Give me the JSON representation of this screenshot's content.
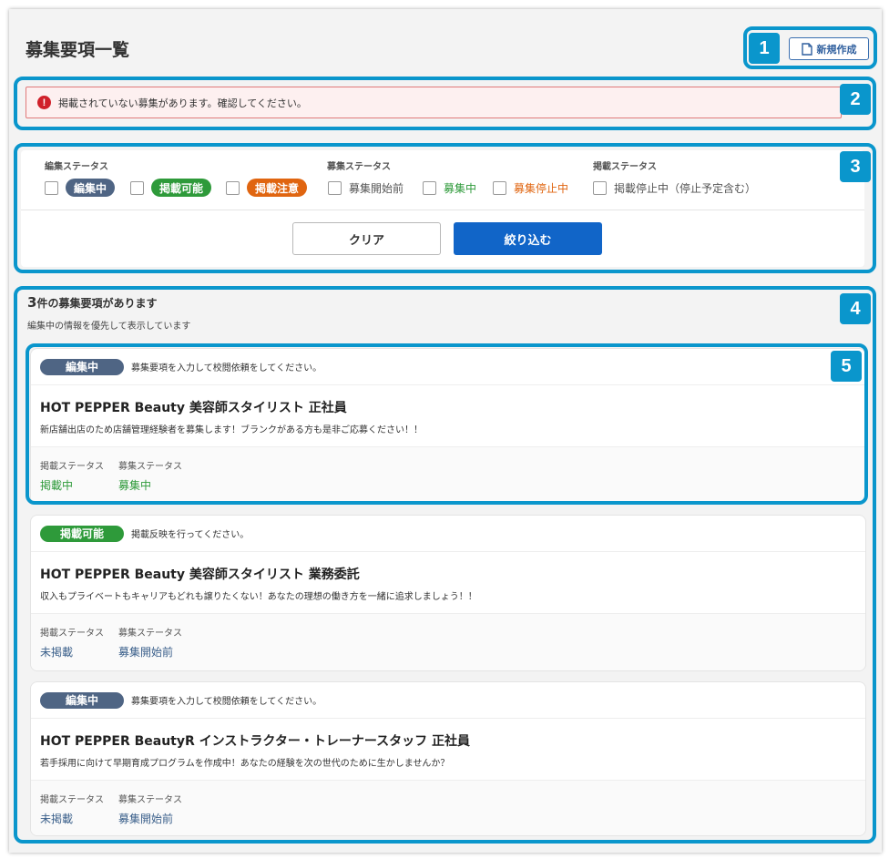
{
  "page": {
    "title": "募集要項一覧",
    "new_button": "新規作成"
  },
  "alert": {
    "icon": "!",
    "message": "掲載されていない募集があります。確認してください。"
  },
  "filters": {
    "edit_status": {
      "label": "編集ステータス",
      "options": [
        "編集中",
        "掲載可能",
        "掲載注意"
      ]
    },
    "recruit_status": {
      "label": "募集ステータス",
      "options": [
        "募集開始前",
        "募集中",
        "募集停止中"
      ]
    },
    "publish_status": {
      "label": "掲載ステータス",
      "options": [
        "掲載停止中（停止予定含む）"
      ]
    },
    "clear_button": "クリア",
    "apply_button": "絞り込む"
  },
  "list": {
    "count_number": "3",
    "count_suffix": "件の募集要項があります",
    "note": "編集中の情報を優先して表示しています",
    "items": [
      {
        "badge": "編集中",
        "badge_color": "#4f6584",
        "message": "募集要項を入力して校閲依頼をしてください。",
        "title": "HOT PEPPER Beauty 美容師スタイリスト 正社員",
        "description": "新店舗出店のため店舗管理経験者を募集します！ブランクがある方も是非ご応募ください！！",
        "publish_label": "掲載ステータス",
        "publish_value": "掲載中",
        "recruit_label": "募集ステータス",
        "recruit_value": "募集中"
      },
      {
        "badge": "掲載可能",
        "badge_color": "#2e9a3a",
        "message": "掲載反映を行ってください。",
        "title": "HOT PEPPER Beauty 美容師スタイリスト 業務委託",
        "description": "収入もプライベートもキャリアもどれも譲りたくない！あなたの理想の働き方を一緒に追求しましょう！！",
        "publish_label": "掲載ステータス",
        "publish_value": "未掲載",
        "recruit_label": "募集ステータス",
        "recruit_value": "募集開始前"
      },
      {
        "badge": "編集中",
        "badge_color": "#4f6584",
        "message": "募集要項を入力して校閲依頼をしてください。",
        "title": "HOT PEPPER BeautyR インストラクター・トレーナースタッフ 正社員",
        "description": "若手採用に向けて早期育成プログラムを作成中！あなたの経験を次の世代のために生かしませんか？",
        "publish_label": "掲載ステータス",
        "publish_value": "未掲載",
        "recruit_label": "募集ステータス",
        "recruit_value": "募集開始前"
      }
    ]
  },
  "annotations": [
    "1",
    "2",
    "3",
    "4",
    "5"
  ],
  "colors": {
    "highlight": "#0a96cc",
    "primary": "#1165c8",
    "editing": "#4f6584",
    "ok": "#2e9a3a",
    "warn": "#e06510",
    "alert_red": "#d0202a"
  }
}
